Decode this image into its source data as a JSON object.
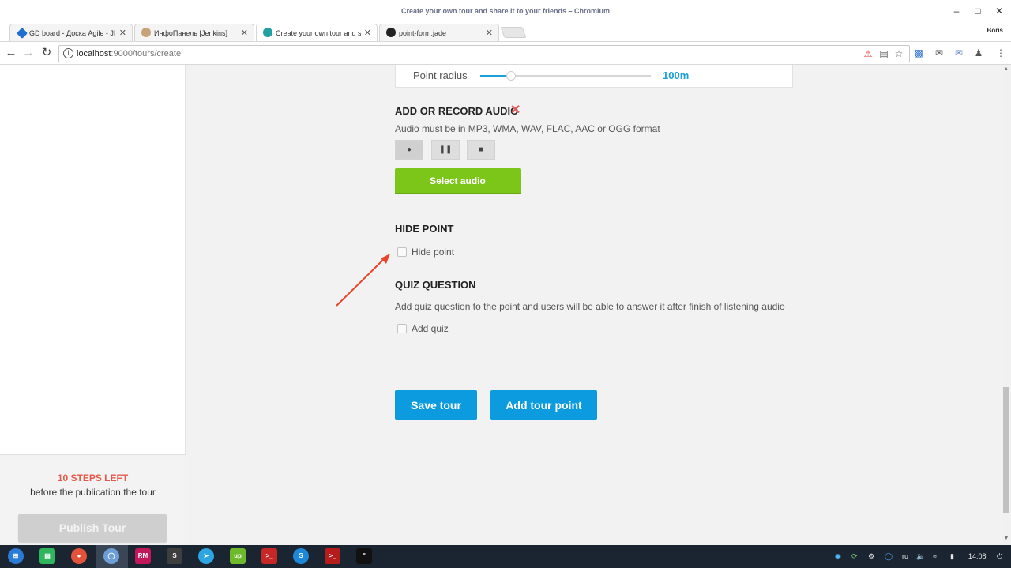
{
  "window": {
    "title": "Create your own tour and share it to your friends – Chromium",
    "user": "Boris"
  },
  "tabs": [
    {
      "label": "GD board - Доска Agile - JIR",
      "fav": "#1f6fd1"
    },
    {
      "label": "ИнфоПанель [Jenkins]",
      "fav": "#c8a27a"
    },
    {
      "label": "Create your own tour and sha",
      "fav": "#22a0a0"
    },
    {
      "label": "point-form.jade",
      "fav": "#222222"
    }
  ],
  "toolbar": {
    "url_host": "localhost",
    "url_rest": ":9000/tours/create"
  },
  "point_radius": {
    "label": "Point radius",
    "value": "100m",
    "slider_fraction": 0.18
  },
  "audio": {
    "title": "ADD OR RECORD AUDIO",
    "hint": "Audio must be in MP3, WMA, WAV, FLAC, AAC or OGG format",
    "select_label": "Select audio"
  },
  "hide_point": {
    "title": "HIDE POINT",
    "checkbox_label": "Hide point"
  },
  "quiz": {
    "title": "QUIZ QUESTION",
    "hint": "Add quiz question to the point and users will be able to answer it after finish of listening audio",
    "checkbox_label": "Add quiz"
  },
  "actions": {
    "save_label": "Save tour",
    "add_point_label": "Add tour point"
  },
  "sidebar": {
    "steps_left": "10 STEPS LEFT",
    "steps_sub": "before the publication the tour",
    "publish_label": "Publish Tour"
  },
  "taskbar": {
    "apps": [
      "start",
      "files",
      "screen-recorder",
      "chromium",
      "rubymine",
      "slack",
      "telegram",
      "upwork",
      "terminal",
      "skype",
      "terminal-2",
      "jetbrains"
    ],
    "lang": "ru",
    "time": "14:08"
  },
  "colors": {
    "accent_blue": "#0d9be0",
    "green": "#7cc61a",
    "alert_red": "#e65a4a"
  }
}
